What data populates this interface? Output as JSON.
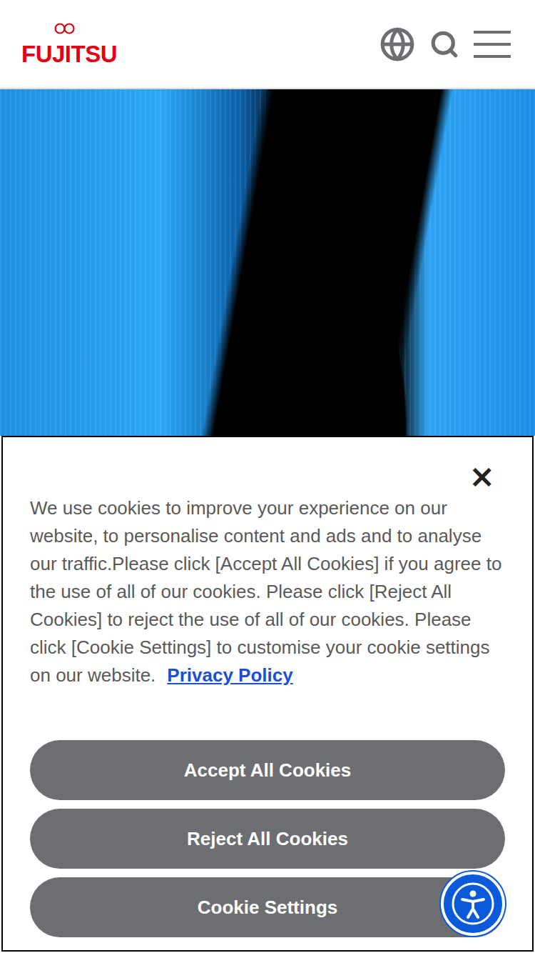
{
  "header": {
    "logo": "FUJITSU"
  },
  "cookie_banner": {
    "close": "×",
    "message": "We use cookies to improve your experience on our website, to personalise content and ads and to analyse our traffic.Please click [Accept All Cookies] if you agree to the use of all of our cookies. Please click [Reject All Cookies] to reject the use of all of our cookies. Please click [Cookie Settings] to customise your cookie settings on our website.",
    "link": "Privacy Policy",
    "buttons": [
      {
        "label": "Accept All Cookies"
      },
      {
        "label": "Reject All Cookies"
      },
      {
        "label": "Cookie Settings"
      }
    ]
  }
}
